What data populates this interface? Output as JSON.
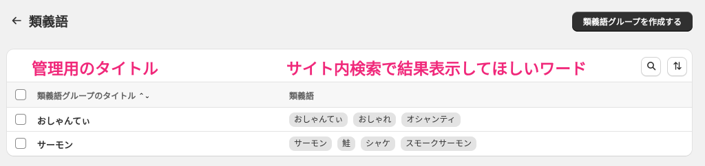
{
  "header": {
    "back_icon": "arrow-left-icon",
    "title": "類義語",
    "create_button": "類義語グループを作成する"
  },
  "annotations": {
    "title_note": "管理用のタイトル",
    "synonyms_note": "サイト内検索で結果表示してほしいワード"
  },
  "toolbar": {
    "search_icon": "search-icon",
    "sort_icon": "sort-icon"
  },
  "table": {
    "columns": {
      "title": "類義語グループのタイトル",
      "synonyms": "類義語"
    },
    "rows": [
      {
        "title": "おしゃんてぃ",
        "tags": [
          "おしゃんてぃ",
          "おしゃれ",
          "オシャンティ"
        ]
      },
      {
        "title": "サーモン",
        "tags": [
          "サーモン",
          "鮭",
          "シャケ",
          "スモークサーモン"
        ]
      }
    ]
  },
  "colors": {
    "annotation": "#f0287a",
    "primary_button": "#303030",
    "background": "#f1f1f1"
  }
}
